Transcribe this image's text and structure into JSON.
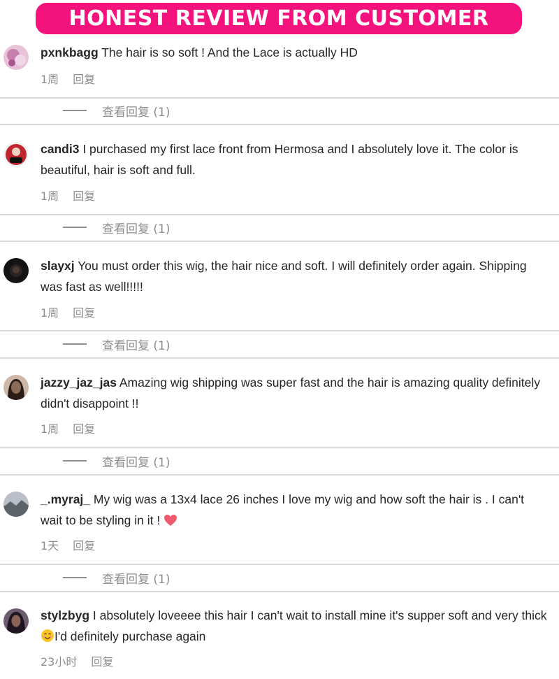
{
  "banner": {
    "title": "HONEST REVIEW FROM CUSTOMER"
  },
  "comments": [
    {
      "username": "pxnkbagg",
      "text": "The hair is so soft ! And the Lace is actually HD",
      "time": "1周",
      "reply": "回复",
      "view_replies": "查看回复 (1)",
      "avatar_color": "#d9a7c7"
    },
    {
      "username": "candi3",
      "text": "I purchased my first lace front from Hermosa and I absolutely love it. The color is beautiful, hair is soft and full.",
      "time": "1周",
      "reply": "回复",
      "view_replies": "查看回复 (1)",
      "avatar_color": "#c0262e"
    },
    {
      "username": "slayxj",
      "text": "You must order this wig, the hair nice and soft. I will definitely order again. Shipping was fast as well!!!!!",
      "time": "1周",
      "reply": "回复",
      "view_replies": "查看回复 (1)",
      "avatar_color": "#1e1b1b"
    },
    {
      "username": "jazzy_jaz_jas",
      "text": "Amazing wig shipping was super fast and the hair is amazing quality definitely didn't disappoint !!",
      "time": "1周",
      "reply": "回复",
      "view_replies": "查看回复 (1)",
      "avatar_color": "#8a6b57"
    },
    {
      "username": "_.myraj_",
      "text": "My wig was a 13x4 lace 26 inches I love my wig and how soft the hair is . I can't wait to be styling in it !",
      "time": "1天",
      "reply": "回复",
      "view_replies": "查看回复 (1)",
      "avatar_color": "#9a9ea6"
    },
    {
      "username": "stylzbyg",
      "text": "I absolutely loveeee this hair I can't wait to install mine it's supper soft and very thick",
      "text_after_emoji": "I'd definitely purchase again",
      "time": "23小时",
      "reply": "回复",
      "avatar_color": "#2b2230"
    }
  ]
}
